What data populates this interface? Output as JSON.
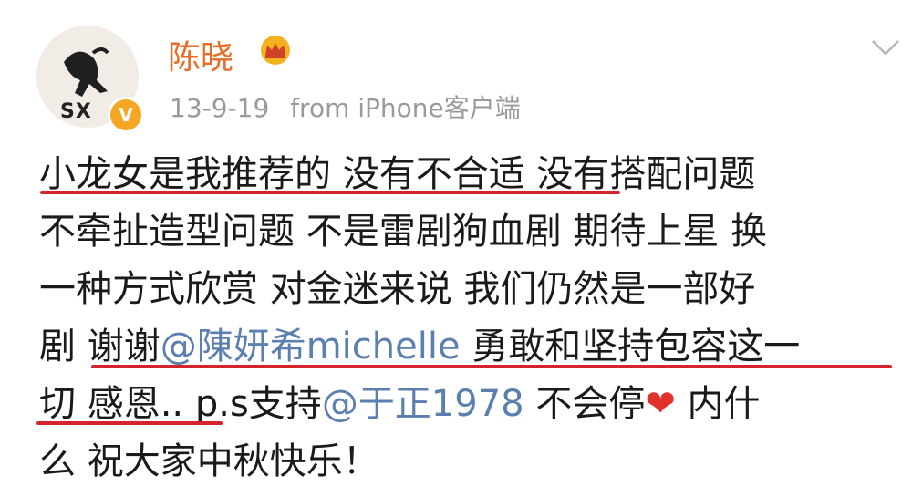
{
  "post": {
    "author": "陈晓",
    "avatar_text": "SX",
    "verified_badge": "V",
    "date": "13-9-19",
    "source": "from iPhone客户端",
    "icons": {
      "crown": "crown-icon",
      "verified": "verified-icon",
      "menu": "chevron-down-icon",
      "heart": "heart-icon"
    },
    "lines": [
      {
        "t1": "小龙女是我推荐的 没有不合适 没有搭配问题"
      },
      {
        "t1": "不牵扯造型问题 不是雷剧狗血剧 期待上星 换"
      },
      {
        "t1": "一种方式欣赏 对金迷来说 我们仍然是一部好"
      },
      {
        "t1": "剧 谢谢",
        "mention": "@陳妍希michelle",
        "t2": " 勇敢和坚持包容这一"
      },
      {
        "t1": "切 感恩.. p.s支持",
        "mention": "@于正1978",
        "t2": " 不会停",
        "heart": "❤",
        "t3": " 内什"
      },
      {
        "t1": "么 祝大家中秋快乐！"
      }
    ]
  },
  "colors": {
    "author": "#e86c25",
    "meta": "#9a9a9a",
    "mention": "#5b7fae",
    "underline": "#d4232b",
    "heart": "#e0312b"
  }
}
